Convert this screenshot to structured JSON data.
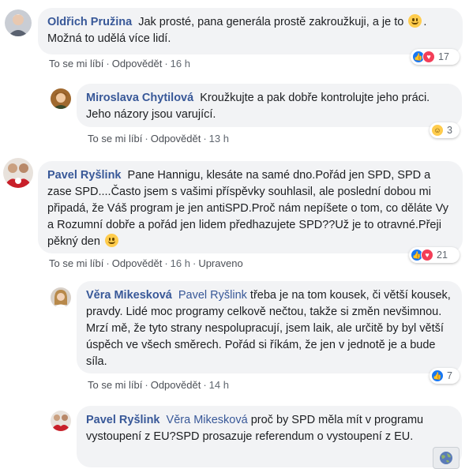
{
  "comments": [
    {
      "author": "Oldřich Pružina",
      "text_parts": [
        "Jak prosté, pana generála prostě zakroužkuji, a je to",
        ". Možná to udělá více lidí."
      ],
      "like_label": "To se mi líbí",
      "reply_label": "Odpovědět",
      "time": "16 h",
      "reaction_count": "17",
      "reactions": [
        "like-icon",
        "love-icon"
      ]
    },
    {
      "author": "Miroslava Chytilová",
      "text": "Kroužkujte a pak dobře kontrolujte jeho práci. Jeho názory jsou varující.",
      "like_label": "To se mi líbí",
      "reply_label": "Odpovědět",
      "time": "13 h",
      "reaction_count": "3",
      "reactions": [
        "haha-icon"
      ]
    },
    {
      "author": "Pavel Ryšlink",
      "text": "Pane Hannigu, klesáte na samé dno.Pořád jen SPD, SPD a zase SPD....Často jsem s vašimi příspěvky souhlasil, ale poslední dobou mi připadá, že Váš program je jen antiSPD.Proč nám nepíšete o tom, co děláte Vy a Rozumní dobře a pořád jen lidem předhazujete SPD??Už je to otravné.Přeji pěkný den",
      "like_label": "To se mi líbí",
      "reply_label": "Odpovědět",
      "time": "16 h",
      "edited_label": "Upraveno",
      "reaction_count": "21",
      "reactions": [
        "like-icon",
        "love-icon"
      ]
    },
    {
      "author": "Věra Mikesková",
      "mention": "Pavel Ryšlink",
      "text": "třeba je na tom kousek, či větší kousek, pravdy. Lidé moc programy celkově nečtou, takže si změn nevšimnou. Mrzí mě, že tyto strany nespolupracují, jsem laik, ale určitě by byl větší úspěch ve všech směrech. Pořád si říkám, že jen v jednotě je a bude síla.",
      "like_label": "To se mi líbí",
      "reply_label": "Odpovědět",
      "time": "14 h",
      "reaction_count": "7",
      "reactions": [
        "like-icon"
      ]
    },
    {
      "author": "Pavel Ryšlink",
      "mention": "Věra Mikesková",
      "text": "proč by SPD měla mít v programu vystoupení z EU?SPD prosazuje referendum o vystoupení z EU."
    }
  ],
  "colors": {
    "link": "#385898",
    "bubble": "#f2f3f5",
    "meta": "#606770",
    "like": "#1877f2",
    "love": "#f33e58",
    "haha": "#ffcc4d"
  },
  "icons": [
    "globe-icon"
  ]
}
